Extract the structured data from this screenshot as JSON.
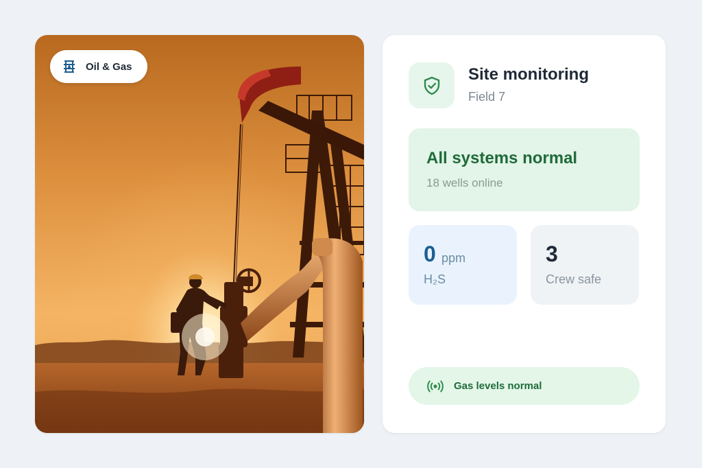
{
  "photo": {
    "tag_label": "Oil & Gas",
    "tag_icon": "oil-barrel-icon"
  },
  "monitor": {
    "title": "Site monitoring",
    "subtitle": "Field 7",
    "header_icon": "shield-check-icon",
    "status": {
      "title": "All systems normal",
      "subtitle": "18 wells online"
    },
    "stats": [
      {
        "value": "0",
        "unit": "ppm",
        "label": "H₂S"
      },
      {
        "value": "3",
        "unit": "",
        "label": "Crew safe"
      }
    ],
    "gas_indicator": {
      "icon": "broadcast-signal-icon",
      "label": "Gas levels normal"
    }
  },
  "colors": {
    "background": "#eef2f6",
    "card": "#ffffff",
    "success_green": "#1f6b3a",
    "success_bg": "#e3f4e8",
    "info_blue": "#1b5f93",
    "info_bg": "#eaf3fd",
    "neutral_bg": "#f0f3f6",
    "photo_orange": "#e08a2c"
  }
}
